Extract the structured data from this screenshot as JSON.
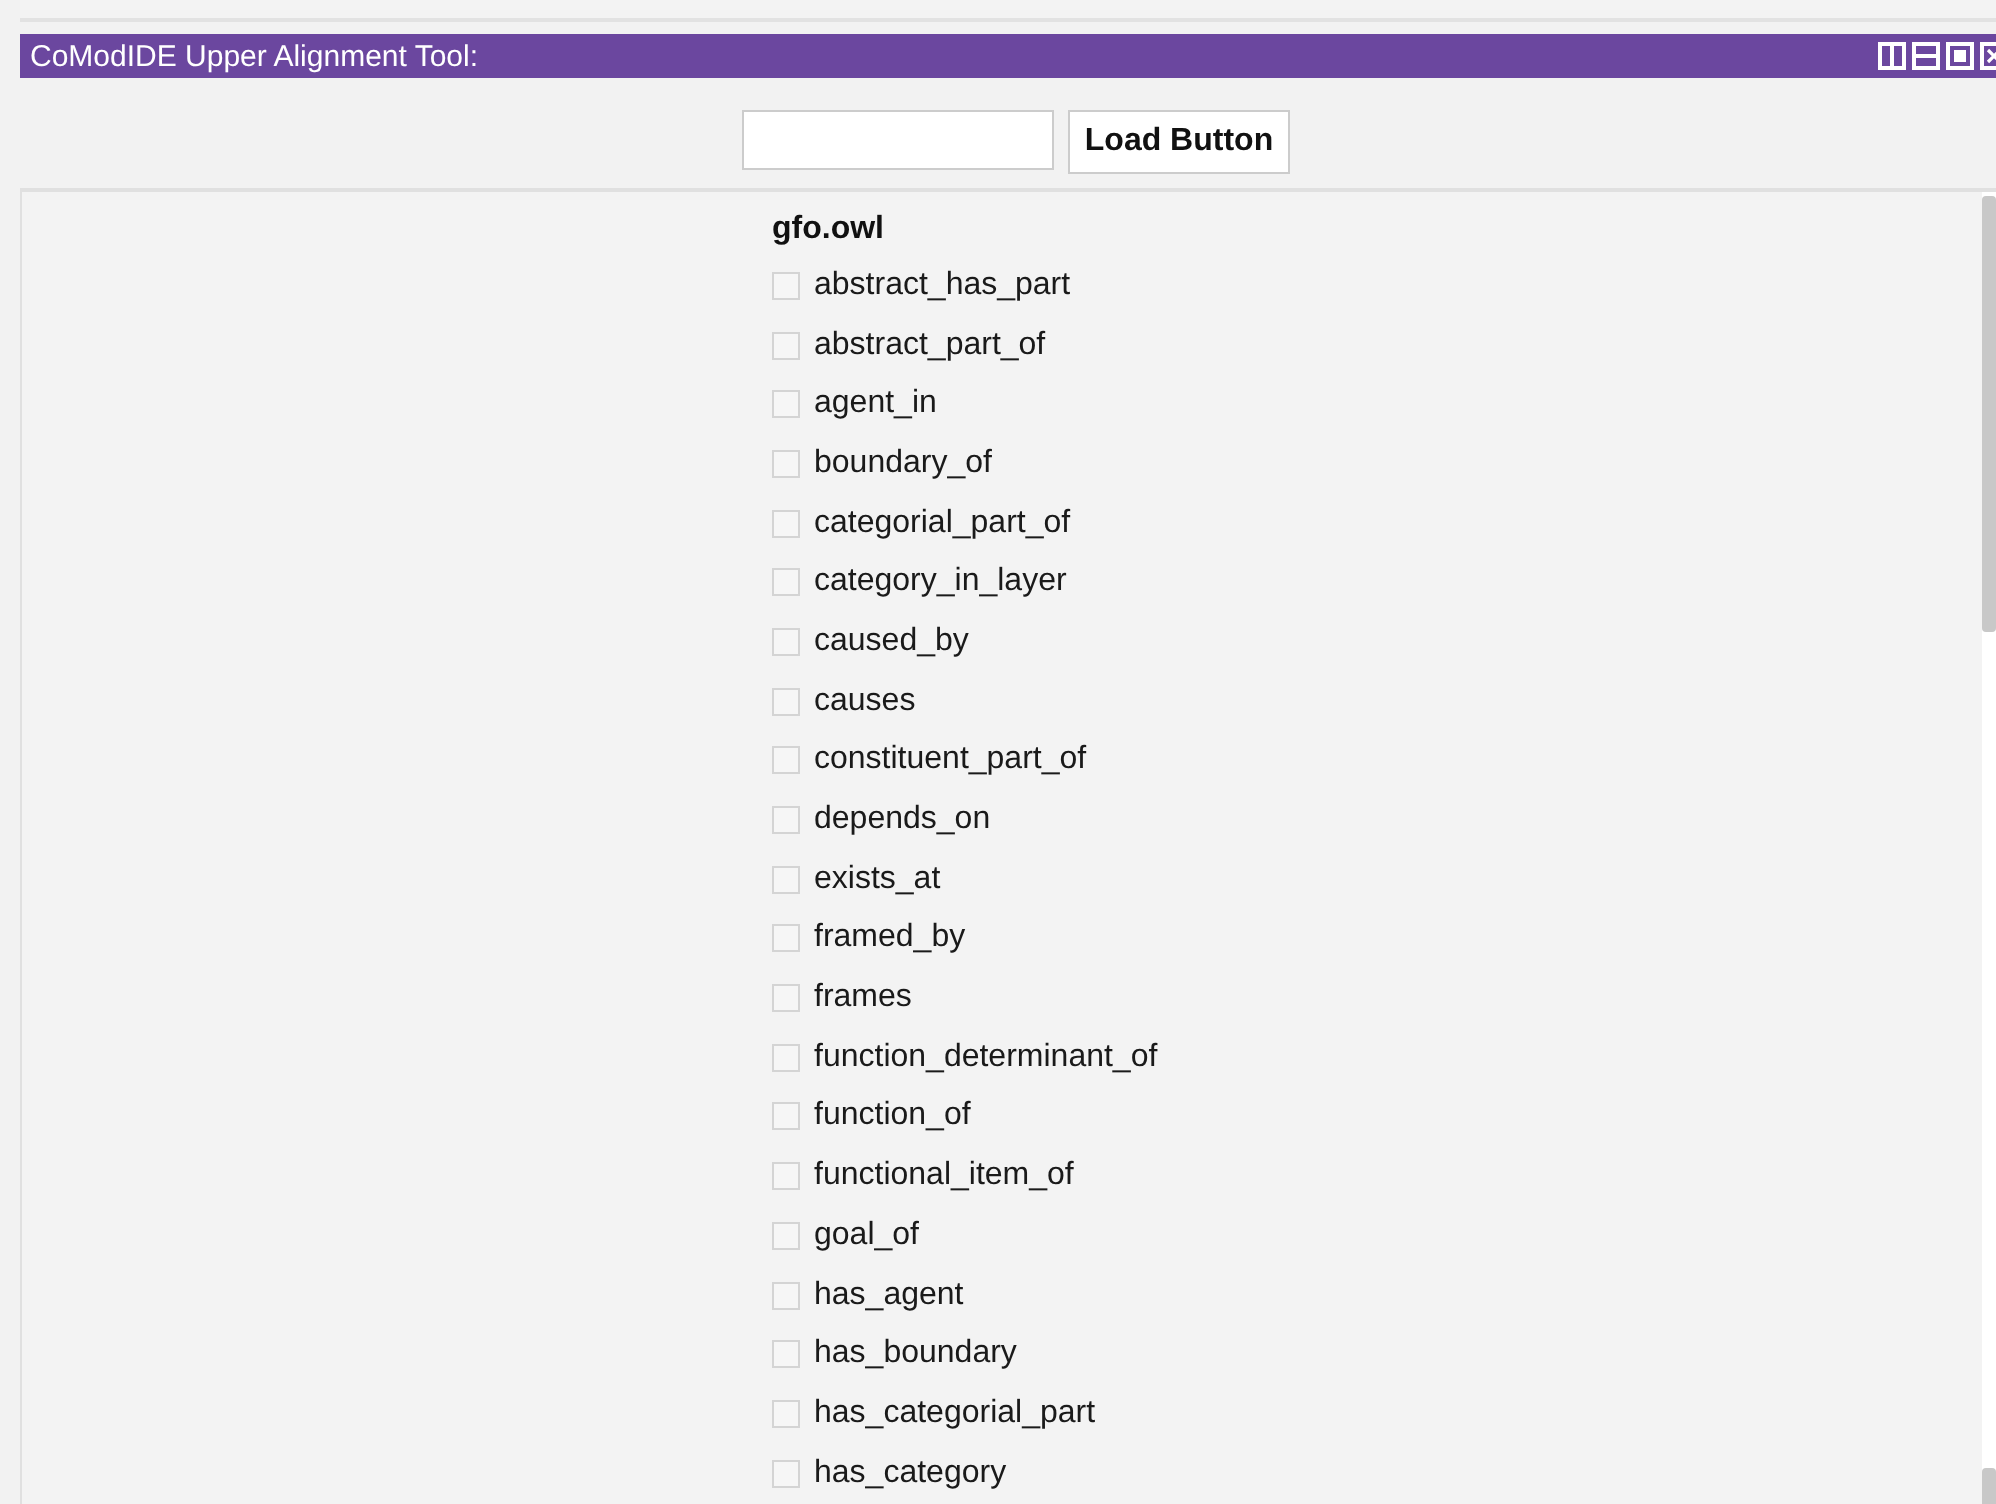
{
  "panel": {
    "title": "CoModIDE Upper Alignment Tool:"
  },
  "load": {
    "button": "Load Button"
  },
  "ontology": {
    "name": "gfo.owl",
    "items": [
      {
        "label": "abstract_has_part",
        "checked": false
      },
      {
        "label": "abstract_part_of",
        "checked": false
      },
      {
        "label": "agent_in",
        "checked": false
      },
      {
        "label": "boundary_of",
        "checked": false
      },
      {
        "label": "categorial_part_of",
        "checked": false
      },
      {
        "label": "category_in_layer",
        "checked": false
      },
      {
        "label": "caused_by",
        "checked": false
      },
      {
        "label": "causes",
        "checked": false
      },
      {
        "label": "constituent_part_of",
        "checked": false
      },
      {
        "label": "depends_on",
        "checked": false
      },
      {
        "label": "exists_at",
        "checked": false
      },
      {
        "label": "framed_by",
        "checked": false
      },
      {
        "label": "frames",
        "checked": false
      },
      {
        "label": "function_determinant_of",
        "checked": false
      },
      {
        "label": "function_of",
        "checked": false
      },
      {
        "label": "functional_item_of",
        "checked": false
      },
      {
        "label": "goal_of",
        "checked": false
      },
      {
        "label": "has_agent",
        "checked": false
      },
      {
        "label": "has_boundary",
        "checked": false
      },
      {
        "label": "has_categorial_part",
        "checked": false
      },
      {
        "label": "has_category",
        "checked": false
      }
    ]
  }
}
